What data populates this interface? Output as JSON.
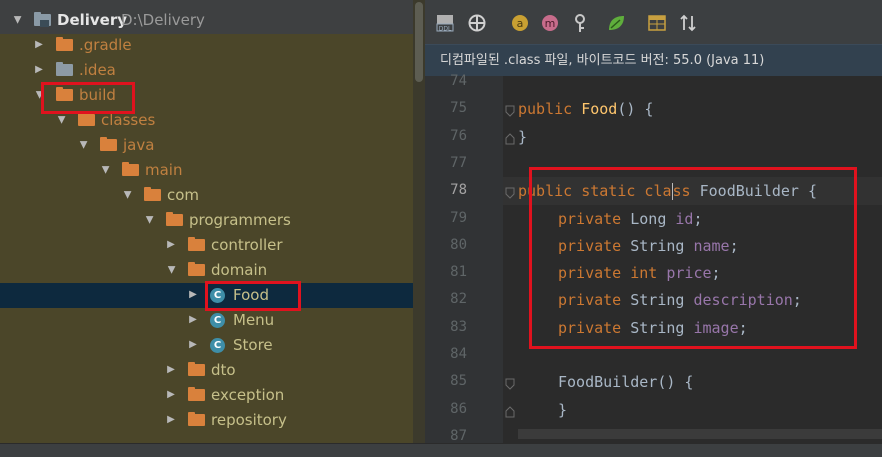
{
  "project_tree": {
    "root": {
      "name": "Delivery",
      "path": "D:\\Delivery"
    },
    "items": [
      {
        "label": ".gradle",
        "depth": 1,
        "kind": "folder-orange",
        "expanded": false
      },
      {
        "label": ".idea",
        "depth": 1,
        "kind": "folder-gray",
        "expanded": false
      },
      {
        "label": "build",
        "depth": 1,
        "kind": "folder-orange",
        "expanded": true
      },
      {
        "label": "classes",
        "depth": 2,
        "kind": "folder-orange",
        "expanded": true
      },
      {
        "label": "java",
        "depth": 3,
        "kind": "folder-orange",
        "expanded": true
      },
      {
        "label": "main",
        "depth": 4,
        "kind": "folder-orange",
        "expanded": true
      },
      {
        "label": "com",
        "depth": 5,
        "kind": "folder-orange",
        "expanded": true
      },
      {
        "label": "programmers",
        "depth": 6,
        "kind": "folder-orange",
        "expanded": true
      },
      {
        "label": "controller",
        "depth": 7,
        "kind": "folder-orange",
        "expanded": false
      },
      {
        "label": "domain",
        "depth": 7,
        "kind": "folder-orange",
        "expanded": true
      },
      {
        "label": "Food",
        "depth": 8,
        "kind": "class",
        "expanded": false,
        "selected": true
      },
      {
        "label": "Menu",
        "depth": 8,
        "kind": "class",
        "expanded": false
      },
      {
        "label": "Store",
        "depth": 8,
        "kind": "class",
        "expanded": false
      },
      {
        "label": "dto",
        "depth": 7,
        "kind": "folder-orange",
        "expanded": false
      },
      {
        "label": "exception",
        "depth": 7,
        "kind": "folder-orange",
        "expanded": false
      },
      {
        "label": "repository",
        "depth": 7,
        "kind": "folder-orange",
        "expanded": false
      }
    ]
  },
  "toolbar": {
    "icons": [
      "ddl-icon",
      "crosshair-icon",
      "annotation-a-icon",
      "method-m-icon",
      "key-icon",
      "spring-leaf-icon",
      "table-icon",
      "sort-icon"
    ]
  },
  "banner": {
    "text": "디컴파일된 .class 파일, 바이트코드 버전: 55.0 (Java 11)"
  },
  "editor": {
    "lines": [
      {
        "n": "74",
        "tokens": []
      },
      {
        "n": "75",
        "indent": 4,
        "tokens": [
          [
            "kw",
            "public "
          ],
          [
            "fn",
            "Food"
          ],
          [
            "p",
            "() {"
          ]
        ]
      },
      {
        "n": "76",
        "indent": 4,
        "tokens": [
          [
            "p",
            "}"
          ]
        ]
      },
      {
        "n": "77",
        "tokens": []
      },
      {
        "n": "78",
        "indent": 4,
        "current": true,
        "tokens": [
          [
            "kw",
            "public static cla"
          ],
          [
            "caret",
            ""
          ],
          [
            "kw",
            "ss "
          ],
          [
            "p",
            "FoodBuilder {"
          ]
        ]
      },
      {
        "n": "79",
        "indent": 8,
        "tokens": [
          [
            "kw",
            "private "
          ],
          [
            "p",
            "Long "
          ],
          [
            "field",
            "id"
          ],
          [
            "p",
            ";"
          ]
        ]
      },
      {
        "n": "80",
        "indent": 8,
        "tokens": [
          [
            "kw",
            "private "
          ],
          [
            "p",
            "String "
          ],
          [
            "field",
            "name"
          ],
          [
            "p",
            ";"
          ]
        ]
      },
      {
        "n": "81",
        "indent": 8,
        "tokens": [
          [
            "kw",
            "private int "
          ],
          [
            "field",
            "price"
          ],
          [
            "p",
            ";"
          ]
        ]
      },
      {
        "n": "82",
        "indent": 8,
        "tokens": [
          [
            "kw",
            "private "
          ],
          [
            "p",
            "String "
          ],
          [
            "field",
            "description"
          ],
          [
            "p",
            ";"
          ]
        ]
      },
      {
        "n": "83",
        "indent": 8,
        "tokens": [
          [
            "kw",
            "private "
          ],
          [
            "p",
            "String "
          ],
          [
            "field",
            "image"
          ],
          [
            "p",
            ";"
          ]
        ]
      },
      {
        "n": "84",
        "tokens": []
      },
      {
        "n": "85",
        "indent": 8,
        "tokens": [
          [
            "p",
            "FoodBuilder() {"
          ]
        ]
      },
      {
        "n": "86",
        "indent": 8,
        "tokens": [
          [
            "p",
            "}"
          ]
        ]
      },
      {
        "n": "87",
        "tokens": []
      }
    ]
  },
  "colors": {
    "tree_bg": "#4b4629",
    "selection": "#0d293e",
    "highlight_box": "#e0121e",
    "keyword": "#cc7832",
    "function": "#ffc66d",
    "field": "#9876aa"
  }
}
